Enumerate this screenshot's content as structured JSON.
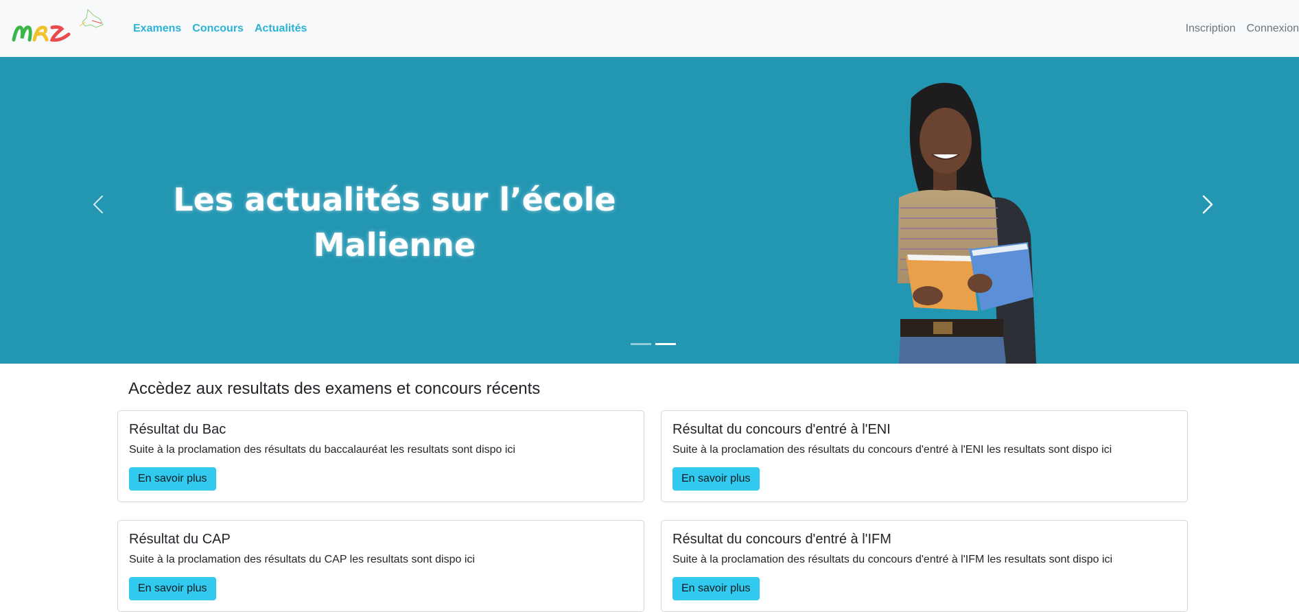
{
  "navbar": {
    "links": [
      "Examens",
      "Concours",
      "Actualités"
    ],
    "right_links": [
      "Inscription",
      "Connexion"
    ]
  },
  "carousel": {
    "caption_line1": "Les actualités sur l’école",
    "caption_line2": "Malienne",
    "slide_count": 2,
    "active_slide": 2,
    "background_color": "#2396b2"
  },
  "results": {
    "title": "Accèdez aux resultats des examens et concours récents",
    "cards": [
      {
        "title": "Résultat du Bac",
        "text": "Suite à la proclamation des résultats du baccalauréat les resultats sont dispo ici",
        "button": "En savoir plus"
      },
      {
        "title": "Résultat du concours d'entré à l'ENI",
        "text": "Suite à la proclamation des résultats du concours d'entré à l'ENI les resultats sont dispo ici",
        "button": "En savoir plus"
      },
      {
        "title": "Résultat du CAP",
        "text": "Suite à la proclamation des résultats du CAP les resultats sont dispo ici",
        "button": "En savoir plus"
      },
      {
        "title": "Résultat du concours d'entré à l'IFM",
        "text": "Suite à la proclamation des résultats du concours d'entré à l'IFM les resultats sont dispo ici",
        "button": "En savoir plus"
      }
    ]
  },
  "colors": {
    "nav_link": "#2bb3d6",
    "button": "#31c9ee"
  }
}
